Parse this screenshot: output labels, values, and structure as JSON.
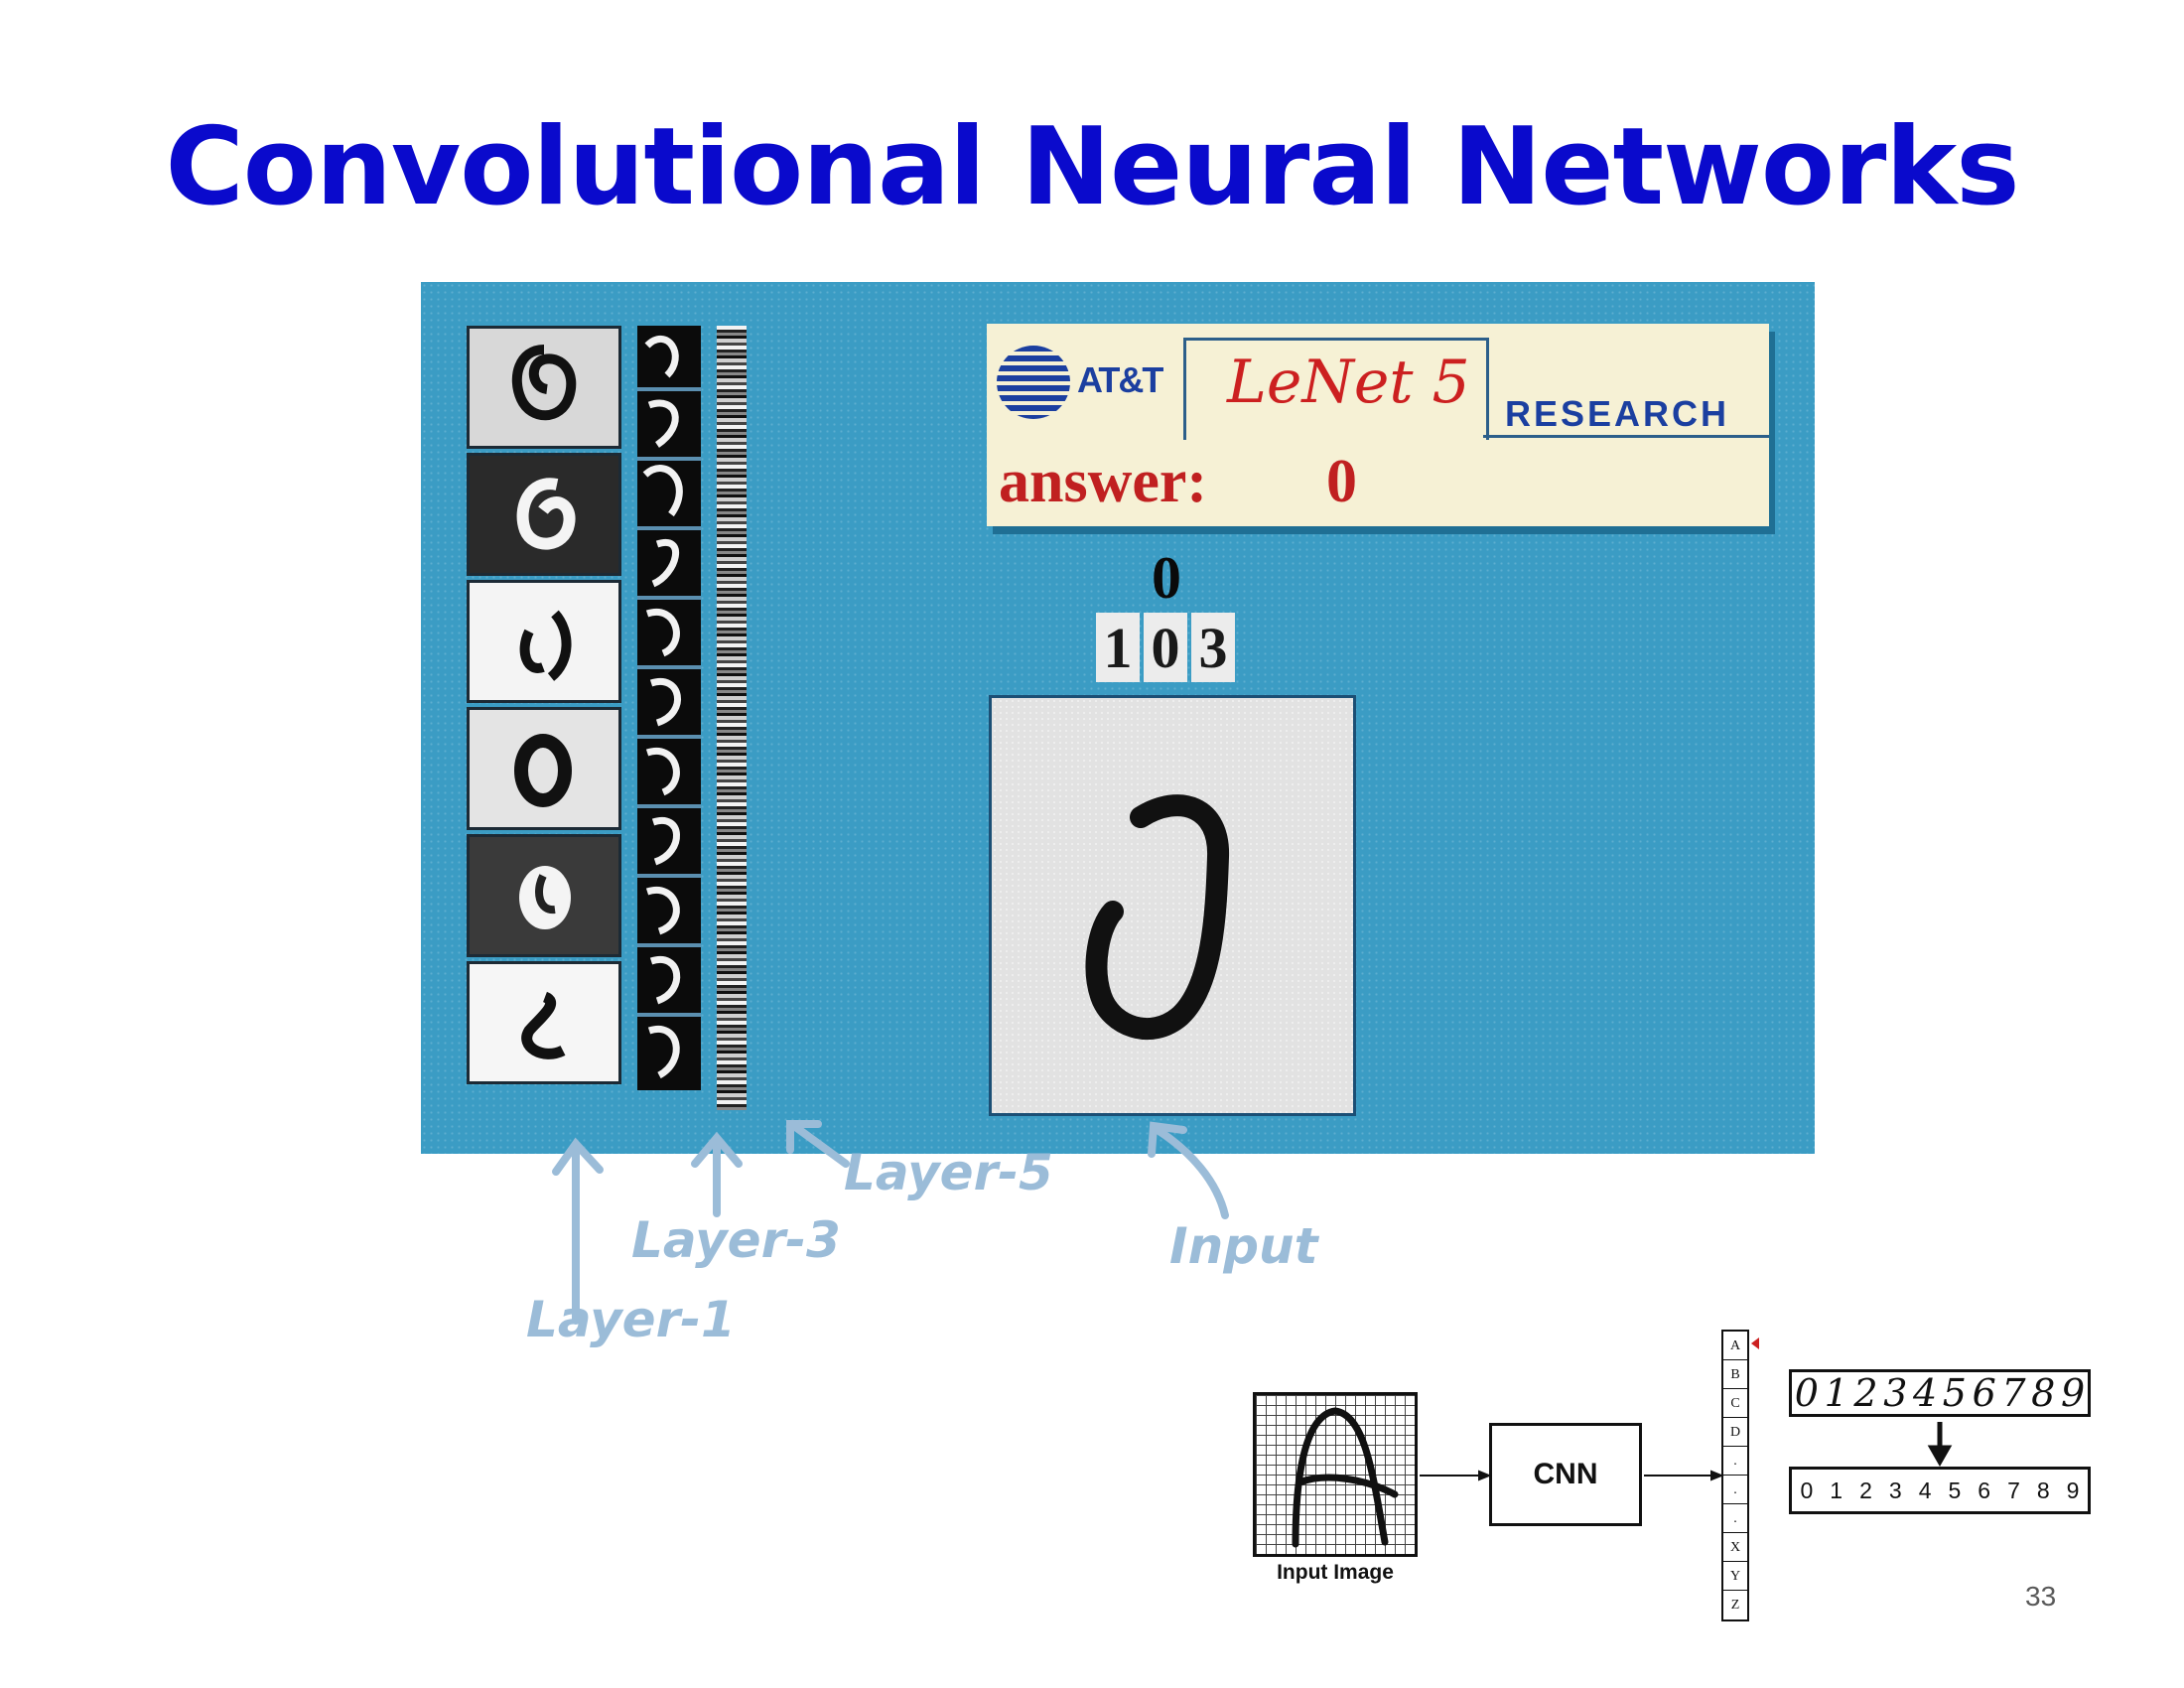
{
  "slide": {
    "title": "Convolutional Neural Networks",
    "page_number": "33",
    "title_color": "#0a0acc"
  },
  "lenet_demo": {
    "logo_text": "AT&T",
    "tab_label": "LeNet 5",
    "research_label": "RESEARCH",
    "answer_label": "answer:",
    "answer_value": "0",
    "predicted_digit": "0",
    "digit_boxes": [
      "1",
      "0",
      "3"
    ],
    "background_color": "#3b9cc4",
    "layer_labels": {
      "layer1": "Layer-1",
      "layer3": "Layer-3",
      "layer5": "Layer-5",
      "input": "Input"
    }
  },
  "cnn_diagram": {
    "input_label": "Input Image",
    "cnn_label": "CNN",
    "letters": [
      "A",
      "B",
      "C",
      "D",
      ".",
      ".",
      ".",
      "X",
      "Y",
      "Z"
    ],
    "handwritten_digits": [
      "0",
      "1",
      "2",
      "3",
      "4",
      "5",
      "6",
      "7",
      "8",
      "9"
    ],
    "printed_digits": [
      "0",
      "1",
      "2",
      "3",
      "4",
      "5",
      "6",
      "7",
      "8",
      "9"
    ]
  }
}
